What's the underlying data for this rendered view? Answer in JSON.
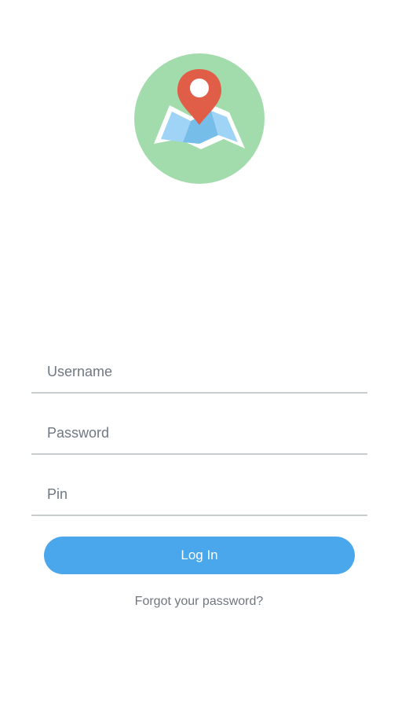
{
  "logo": {
    "icon": "map-location-pin-icon",
    "colors": {
      "circle": "#a2dcad",
      "map_light": "#9fd4f7",
      "map_dark": "#76bde9",
      "map_border": "#ffffff",
      "pin": "#e05e48",
      "pin_hole": "#ffffff"
    }
  },
  "form": {
    "username": {
      "placeholder": "Username",
      "value": ""
    },
    "password": {
      "placeholder": "Password",
      "value": ""
    },
    "pin": {
      "placeholder": "Pin",
      "value": ""
    },
    "login_label": "Log In",
    "forgot_label": "Forgot your password?"
  },
  "colors": {
    "background": "#ffffff",
    "field_underline": "#c7cccf",
    "button_bg": "#4aa7ec",
    "button_text": "#ffffff",
    "placeholder_text": "#6f7780",
    "link_text": "#6f767e"
  }
}
